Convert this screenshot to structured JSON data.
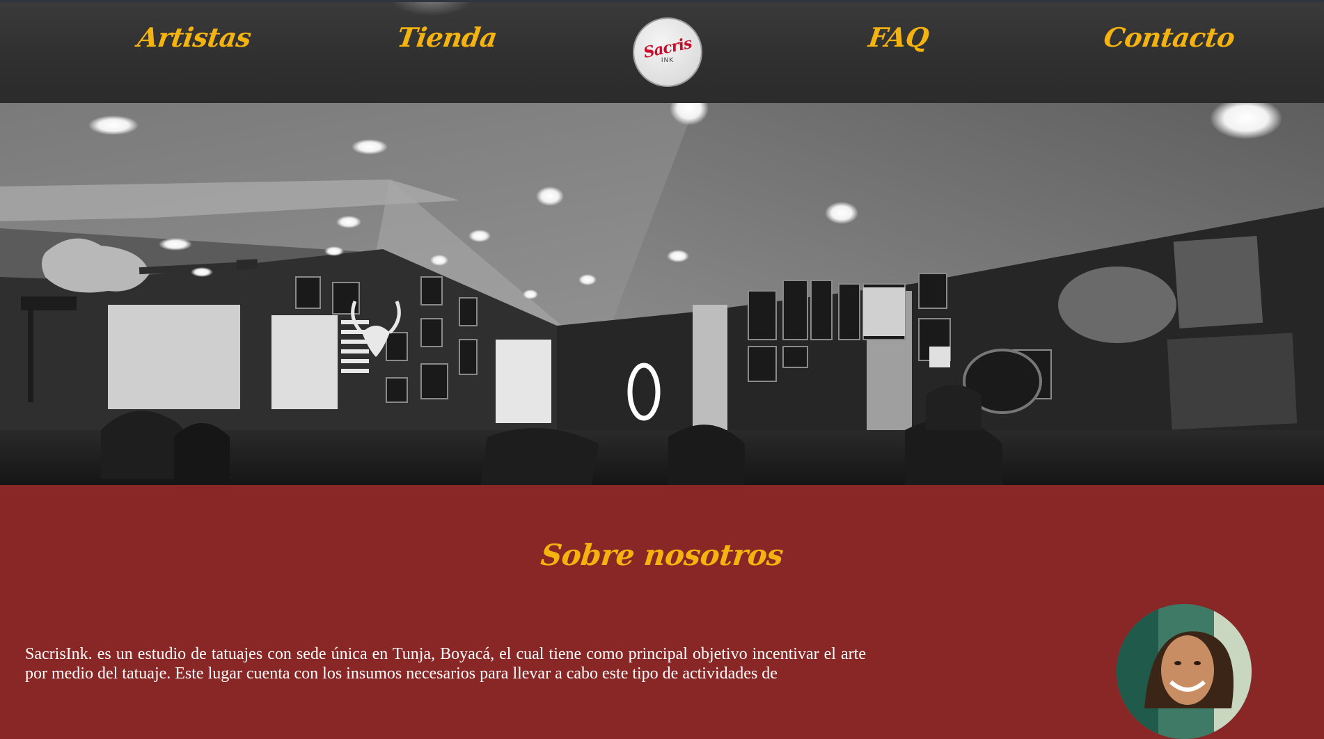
{
  "nav": {
    "items": [
      {
        "label": "Artistas"
      },
      {
        "label": "Tienda"
      },
      {
        "label": "FAQ"
      },
      {
        "label": "Contacto"
      }
    ],
    "logo": {
      "mark": "Sacris",
      "sub": "INK"
    }
  },
  "about": {
    "title": "Sobre nosotros",
    "text": "SacrisInk. es un estudio de tatuajes con sede única en Tunja, Boyacá, el cual tiene como principal objetivo incentivar el arte por medio del tatuaje. Este lugar cuenta con los insumos necesarios para llevar a cabo este tipo de actividades de"
  },
  "colors": {
    "accent": "#f5b30f",
    "section_bg": "#892727",
    "header_bg": "#333333",
    "logo_red": "#c8102e"
  },
  "icons": {
    "logo": "sacrisink-logo",
    "avatar": "team-member-photo"
  }
}
